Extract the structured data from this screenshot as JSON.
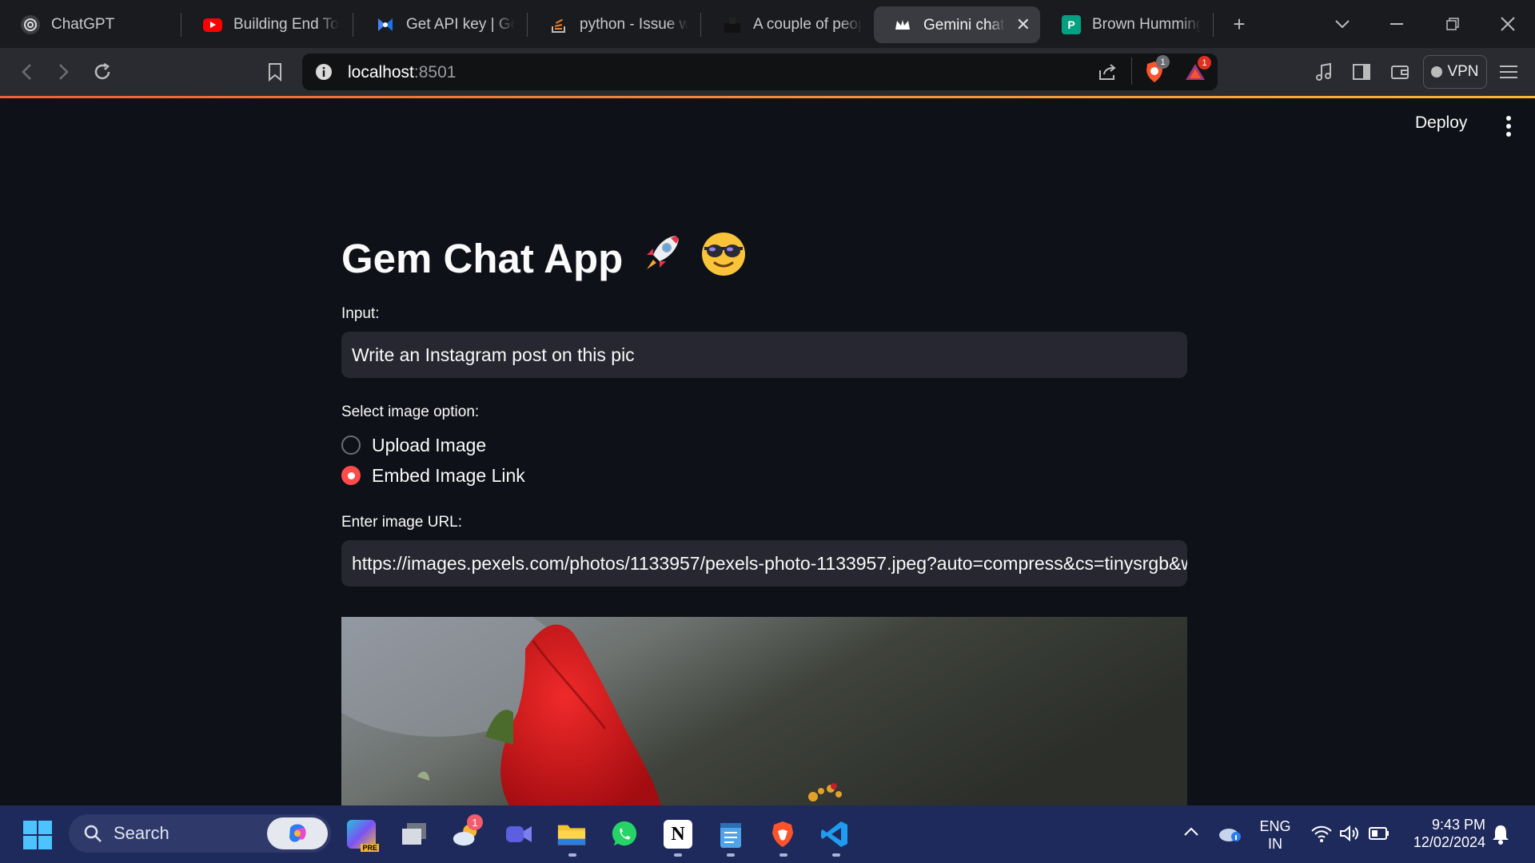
{
  "browser": {
    "tabs": [
      {
        "label": "ChatGPT",
        "icon": "chatgpt-icon",
        "active": false
      },
      {
        "label": "Building End To En",
        "icon": "youtube-icon",
        "active": false
      },
      {
        "label": "Get API key | Goog",
        "icon": "ai-studio-icon",
        "active": false
      },
      {
        "label": "python - Issue wit",
        "icon": "stackoverflow-icon",
        "active": false
      },
      {
        "label": "A couple of people",
        "icon": "pexels-icon",
        "active": false
      },
      {
        "label": "Gemini chat🔥",
        "icon": "streamlit-crown-icon",
        "active": true
      },
      {
        "label": "Brown Hummingb",
        "icon": "pexels-p-icon",
        "active": false
      }
    ],
    "url": {
      "host": "localhost",
      "port": ":8501"
    },
    "vpn_label": "VPN",
    "brave_badge": "1",
    "rewards_badge": "1"
  },
  "app": {
    "deploy_label": "Deploy",
    "title": "Gem Chat App",
    "title_emojis": [
      "rocket",
      "sunglasses-face"
    ],
    "input_label": "Input:",
    "input_value": "Write an Instagram post on this pic",
    "radio_label": "Select image option:",
    "radio_options": [
      {
        "label": "Upload Image",
        "selected": false
      },
      {
        "label": "Embed Image Link",
        "selected": true
      }
    ],
    "url_label": "Enter image URL:",
    "url_value": "https://images.pexels.com/photos/1133957/pexels-photo-1133957.jpeg?auto=compress&cs=tinysrgb&w",
    "accent": "#ff4b4b"
  },
  "taskbar": {
    "search_label": "Search",
    "weather_badge": "1",
    "lang_top": "ENG",
    "lang_bottom": "IN",
    "time": "9:43 PM",
    "date": "12/02/2024"
  }
}
